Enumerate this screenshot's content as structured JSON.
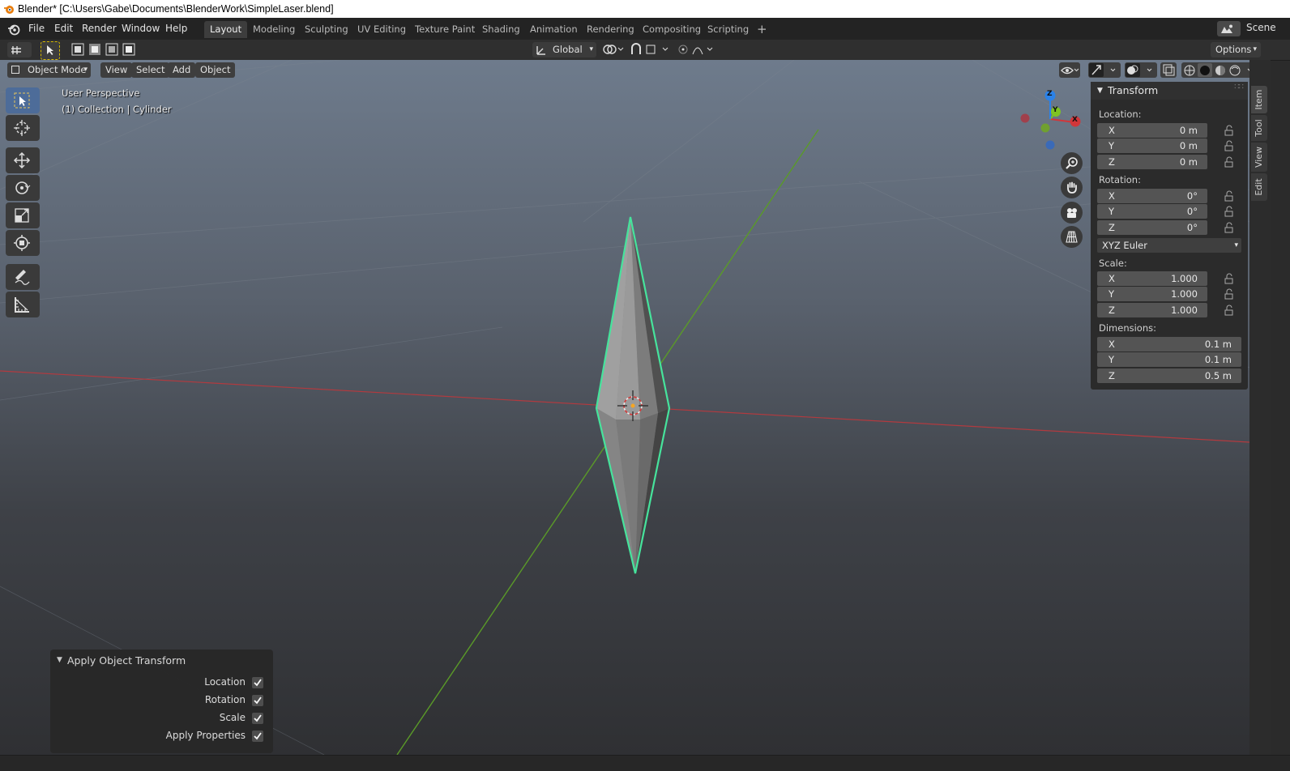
{
  "window": {
    "title": "Blender* [C:\\Users\\Gabe\\Documents\\BlenderWork\\SimpleLaser.blend]"
  },
  "menu": {
    "items": [
      "File",
      "Edit",
      "Render",
      "Window",
      "Help"
    ]
  },
  "workspaces": {
    "tabs": [
      "Layout",
      "Modeling",
      "Sculpting",
      "UV Editing",
      "Texture Paint",
      "Shading",
      "Animation",
      "Rendering",
      "Compositing",
      "Scripting"
    ],
    "active": "Layout",
    "add": "+",
    "scene_label": "Scene"
  },
  "header": {
    "orientation": "Global",
    "options_label": "Options"
  },
  "viewport_header": {
    "mode": "Object Mode",
    "menus": [
      "View",
      "Select",
      "Add",
      "Object"
    ]
  },
  "viewport": {
    "perspective_label": "User Perspective",
    "collection_label": "(1) Collection | Cylinder",
    "gizmo": {
      "x": "X",
      "y": "Y",
      "z": "Z"
    }
  },
  "transform_panel": {
    "title": "Transform",
    "location_label": "Location:",
    "location": [
      {
        "axis": "X",
        "value": "0 m"
      },
      {
        "axis": "Y",
        "value": "0 m"
      },
      {
        "axis": "Z",
        "value": "0 m"
      }
    ],
    "rotation_label": "Rotation:",
    "rotation": [
      {
        "axis": "X",
        "value": "0°"
      },
      {
        "axis": "Y",
        "value": "0°"
      },
      {
        "axis": "Z",
        "value": "0°"
      }
    ],
    "rotation_mode": "XYZ Euler",
    "scale_label": "Scale:",
    "scale": [
      {
        "axis": "X",
        "value": "1.000"
      },
      {
        "axis": "Y",
        "value": "1.000"
      },
      {
        "axis": "Z",
        "value": "1.000"
      }
    ],
    "dimensions_label": "Dimensions:",
    "dimensions": [
      {
        "axis": "X",
        "value": "0.1 m"
      },
      {
        "axis": "Y",
        "value": "0.1 m"
      },
      {
        "axis": "Z",
        "value": "0.5 m"
      }
    ]
  },
  "side_tabs": [
    "Item",
    "Tool",
    "View",
    "Edit"
  ],
  "redo_panel": {
    "title": "Apply Object Transform",
    "options": [
      {
        "label": "Location",
        "checked": true
      },
      {
        "label": "Rotation",
        "checked": true
      },
      {
        "label": "Scale",
        "checked": true
      },
      {
        "label": "Apply Properties",
        "checked": true
      }
    ]
  },
  "colors": {
    "accent": "#4d6c99",
    "selection_outline": "#46e39c",
    "axis_x": "#d1363a",
    "axis_y": "#7ec322",
    "axis_z": "#2b82e8"
  }
}
